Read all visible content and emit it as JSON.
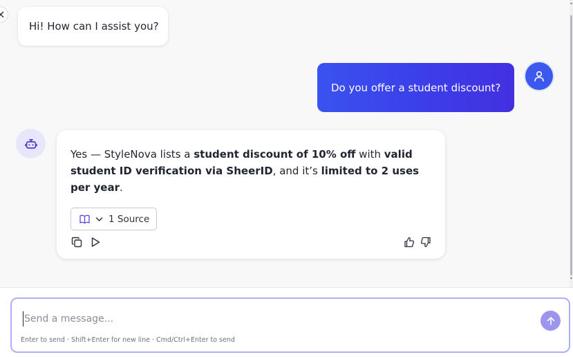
{
  "messages": {
    "greeting": "Hi! How can I assist you?",
    "user_question": "Do you offer a student discount?",
    "answer": {
      "p1": "Yes — StyleNova lists a ",
      "b1": "student discount of 10% off",
      "p2": " with ",
      "b2": "valid student ID verification via SheerID",
      "p3": ", and it’s ",
      "b3": "limited to 2 uses per year",
      "p4": "."
    },
    "sources_label": "1 Source"
  },
  "composer": {
    "placeholder": "Send a message...",
    "value": "",
    "hint": "Enter to send · Shift+Enter for new line · Cmd/Ctrl+Enter to send"
  },
  "icons": {
    "close": "close-icon",
    "user_avatar": "user-icon",
    "bot_avatar": "bot-icon",
    "source_book": "book-icon",
    "chevron": "chevron-down-icon",
    "copy": "copy-icon",
    "play": "play-icon",
    "thumbs_up": "thumbs-up-icon",
    "thumbs_down": "thumbs-down-icon",
    "send": "arrow-up-icon"
  },
  "colors": {
    "accent": "#3c3ce8",
    "send_button": "#9c95ee",
    "composer_border": "#a9b0f5",
    "bot_avatar_bg": "#e8e6fb"
  }
}
